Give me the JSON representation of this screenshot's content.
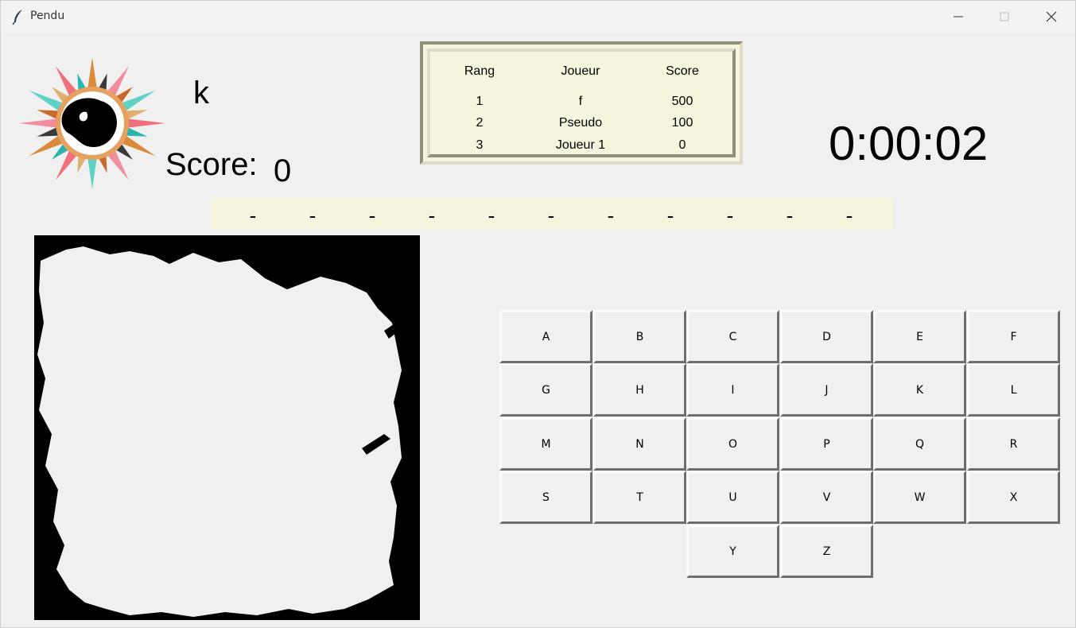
{
  "window": {
    "title": "Pendu"
  },
  "player": {
    "pseudo": "k",
    "score_label": "Score:",
    "score": "0"
  },
  "leaderboard": {
    "headers": [
      "Rang",
      "Joueur",
      "Score"
    ],
    "rows": [
      [
        "1",
        "f",
        "500"
      ],
      [
        "2",
        "Pseudo",
        "100"
      ],
      [
        "3",
        "Joueur 1",
        "0"
      ]
    ]
  },
  "timer": "0:00:02",
  "word": [
    "-",
    "-",
    "-",
    "-",
    "-",
    "-",
    "-",
    "-",
    "-",
    "-",
    "-"
  ],
  "keyboard": [
    "A",
    "B",
    "C",
    "D",
    "E",
    "F",
    "G",
    "H",
    "I",
    "J",
    "K",
    "L",
    "M",
    "N",
    "O",
    "P",
    "Q",
    "R",
    "S",
    "T",
    "U",
    "V",
    "W",
    "X",
    "Y",
    "Z"
  ],
  "colors": {
    "panel_bg": "#f5f4dc",
    "window_bg": "#f0f0f0",
    "frame": "#000000"
  },
  "icons": [
    "feather-icon",
    "minimize-icon",
    "maximize-icon",
    "close-icon"
  ]
}
